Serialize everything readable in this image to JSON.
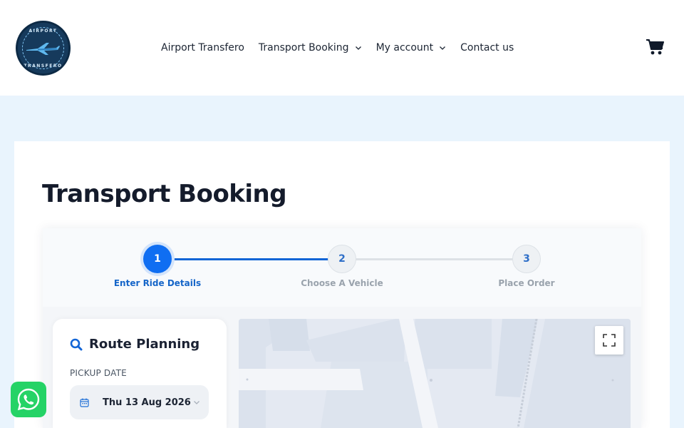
{
  "header": {
    "logo": {
      "text_top": "AIRPORT",
      "text_bottom": "TRANSFERO",
      "icon": "plane-logo-icon"
    },
    "nav": [
      {
        "label": "Airport Transfero",
        "has_dropdown": false
      },
      {
        "label": "Transport Booking",
        "has_dropdown": true
      },
      {
        "label": "My account",
        "has_dropdown": true
      },
      {
        "label": "Contact us",
        "has_dropdown": false
      }
    ],
    "cart_icon": "cart-icon"
  },
  "page": {
    "title": "Transport Booking"
  },
  "steps": [
    {
      "number": "1",
      "label": "Enter Ride Details",
      "state": "active"
    },
    {
      "number": "2",
      "label": "Choose A Vehicle",
      "state": "idle"
    },
    {
      "number": "3",
      "label": "Place Order",
      "state": "idle"
    }
  ],
  "route": {
    "title": "Route Planning",
    "pickup_date_label": "PICKUP DATE",
    "pickup_date_value": "Thu 13 Aug 2026"
  },
  "map": {
    "fullscreen_icon": "fullscreen-icon"
  },
  "whatsapp": {
    "icon": "whatsapp-icon"
  },
  "colors": {
    "accent": "#0f6ef2",
    "page_bg": "#e9f4fd",
    "whatsapp": "#25d366"
  }
}
